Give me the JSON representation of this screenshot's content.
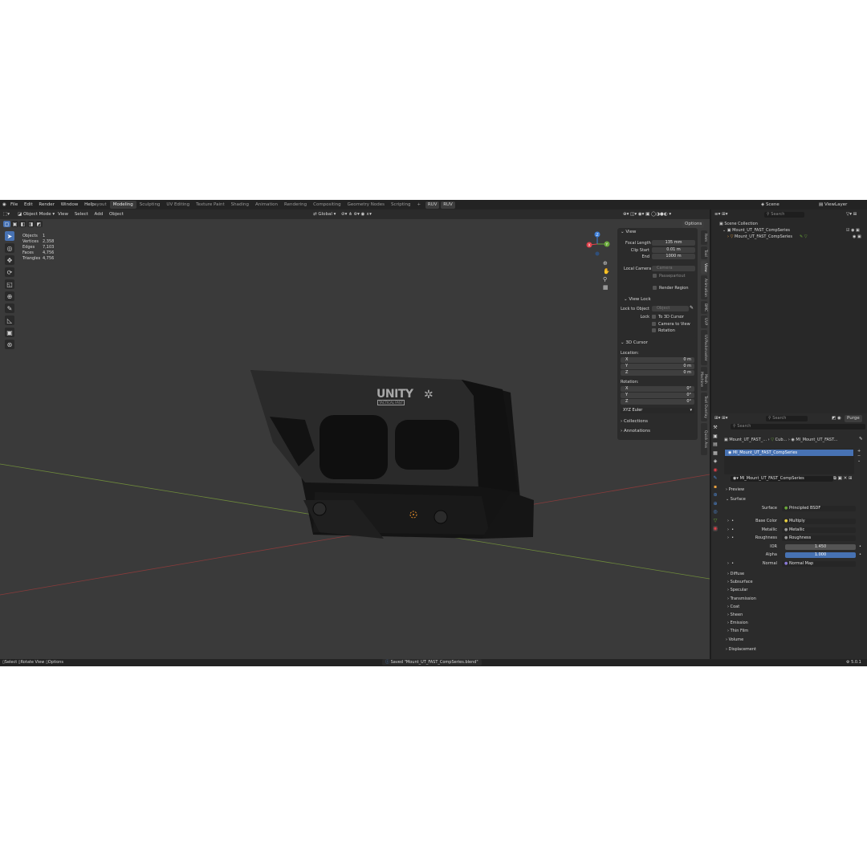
{
  "topbar": {
    "menus": [
      "File",
      "Edit",
      "Render",
      "Window",
      "Help"
    ],
    "workspaces": [
      "Layout",
      "Modeling",
      "Sculpting",
      "UV Editing",
      "Texture Paint",
      "Shading",
      "Animation",
      "Rendering",
      "Compositing",
      "Geometry Nodes",
      "Scripting"
    ],
    "active_workspace": "Modeling",
    "addon_buttons": [
      "RUV",
      "RUV"
    ],
    "scene_label": "Scene",
    "viewlayer_label": "ViewLayer"
  },
  "viewport_header": {
    "mode": "Object Mode",
    "menus": [
      "View",
      "Select",
      "Add",
      "Object"
    ],
    "orientation": "Global",
    "options": "Options"
  },
  "stats": [
    {
      "label": "Objects",
      "value": "1"
    },
    {
      "label": "Vertices",
      "value": "2,358"
    },
    {
      "label": "Edges",
      "value": "7,103"
    },
    {
      "label": "Faces",
      "value": "4,756"
    },
    {
      "label": "Triangles",
      "value": "4,756"
    }
  ],
  "model": {
    "logo": "UNITY",
    "subline": "TACTICAL  FAST"
  },
  "gizmo": {
    "x": "X",
    "y": "Y",
    "z": "Z"
  },
  "npanel": {
    "view_title": "View",
    "focal_label": "Focal Length",
    "focal_value": "135 mm",
    "clip_start_label": "Clip Start",
    "clip_start_value": "0.01 m",
    "end_label": "End",
    "end_value": "1000 m",
    "local_camera_label": "Local Camera",
    "local_camera_value": "Camera",
    "render_region": "Render Region",
    "view_lock_title": "View Lock",
    "lock_to_object_label": "Lock to Object",
    "lock_to_object_value": "Object",
    "lock_label": "Lock",
    "to_3d_cursor": "To 3D Cursor",
    "camera_to_view": "Camera to View",
    "rotation": "Rotation",
    "cursor_title": "3D Cursor",
    "location_label": "Location:",
    "loc": [
      {
        "axis": "X",
        "value": "0 m"
      },
      {
        "axis": "Y",
        "value": "0 m"
      },
      {
        "axis": "Z",
        "value": "0 m"
      }
    ],
    "rotation_label": "Rotation:",
    "rot": [
      {
        "axis": "X",
        "value": "0°"
      },
      {
        "axis": "Y",
        "value": "0°"
      },
      {
        "axis": "Z",
        "value": "0°"
      }
    ],
    "euler": "XYZ Euler",
    "collections": "Collections",
    "annotations": "Annotations",
    "tabs": [
      "Item",
      "Tool",
      "View",
      "Animation",
      "BMC",
      "UVP",
      "UVPackmaster",
      "Mesh Machine",
      "Text Overlay",
      "Quick Ass"
    ]
  },
  "outliner": {
    "search_placeholder": "Search",
    "scene_collection": "Scene Collection",
    "collection": "Mount_UT_FAST_CompSeries",
    "object": "Mount_UT_FAST_CompSeries"
  },
  "properties": {
    "search_placeholder": "Search",
    "purge": "Purge",
    "breadcrumb": [
      "Mount_UT_FAST_...",
      "Cub...",
      "MI_Mount_UT_FAST..."
    ],
    "slot": "MI_Mount_UT_FAST_CompSeries",
    "material": "MI_Mount_UT_FAST_CompSeries",
    "preview": "Preview",
    "surface": "Surface",
    "surface_label": "Surface",
    "surface_value": "Principled BSDF",
    "inputs": [
      {
        "label": "Base Color",
        "value": "Multiply"
      },
      {
        "label": "Metallic",
        "value": "Metallic"
      },
      {
        "label": "Roughness",
        "value": "Roughness"
      },
      {
        "label": "IOR",
        "value": "1.450"
      },
      {
        "label": "Alpha",
        "value": "1.000"
      },
      {
        "label": "Normal",
        "value": "Normal Map"
      }
    ],
    "subpanels": [
      "Diffuse",
      "Subsurface",
      "Specular",
      "Transmission",
      "Coat",
      "Sheen",
      "Emission",
      "Thin Film"
    ],
    "volume": "Volume",
    "displacement": "Displacement"
  },
  "statusbar": {
    "select": "Select",
    "rotate_view": "Rotate View",
    "options": "Options",
    "message": "Saved \"Mount_UT_FAST_CompSeries.blend\"",
    "version": "5.0.1"
  },
  "colors": {
    "accent": "#4772b3",
    "x_axis": "#e0404a",
    "y_axis": "#6aa83a",
    "z_axis": "#3d7fd8"
  }
}
